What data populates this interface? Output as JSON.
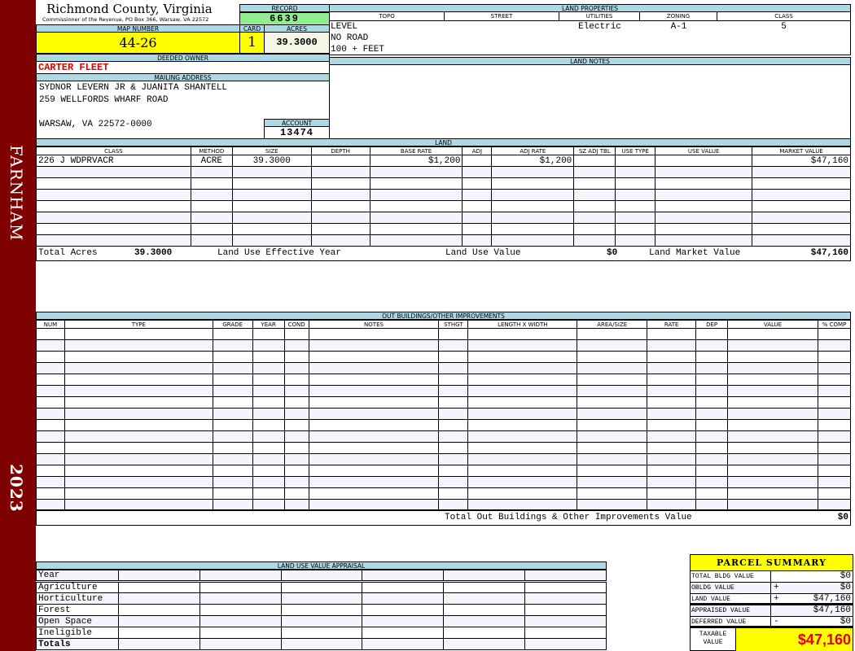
{
  "side": {
    "district": "FARNHAM",
    "year": "2023"
  },
  "header": {
    "title": "Richmond County, Virginia",
    "subtitle": "Commissioner of the Revenue, PO Box 366, Warsaw, VA 22572"
  },
  "record": {
    "label": "RECORD",
    "value": "6639"
  },
  "map": {
    "label": "MAP NUMBER",
    "value": "44-26"
  },
  "card": {
    "label": "CARD",
    "value": "1"
  },
  "acres": {
    "label": "ACRES",
    "value": "39.3000"
  },
  "owner": {
    "label": "DEEDED OWNER",
    "value": "CARTER FLEET"
  },
  "mailing": {
    "label": "MAILING ADDRESS",
    "line1": "SYDNOR LEVERN JR & JUANITA SHANTELL",
    "line2": "259 WELLFORDS WHARF ROAD",
    "line3": "WARSAW, VA 22572-0000"
  },
  "account": {
    "label": "ACCOUNT",
    "value": "13474"
  },
  "land_properties": {
    "label": "LAND PROPERTIES",
    "columns": [
      "TOPO",
      "STREET",
      "UTILITIES",
      "ZONING",
      "CLASS"
    ],
    "topo": [
      "LEVEL",
      "NO ROAD",
      "100 + FEET"
    ],
    "street": "",
    "utilities": "Electric",
    "zoning": "A-1",
    "class": "5"
  },
  "land_notes": {
    "label": "LAND NOTES"
  },
  "land": {
    "label": "LAND",
    "columns": [
      "CLASS",
      "METHOD",
      "SIZE",
      "DEPTH",
      "BASE RATE",
      "ADJ",
      "ADJ RATE",
      "SZ ADJ TBL",
      "USE TYPE",
      "USE VALUE",
      "MARKET VALUE"
    ],
    "rows": [
      [
        "226 J WDPRVACR",
        "ACRE",
        "39.3000",
        "",
        "$1,200",
        "",
        "$1,200",
        "",
        "",
        "",
        "$47,160"
      ]
    ],
    "totals": {
      "acres_label": "Total Acres",
      "acres": "39.3000",
      "eff_label": "Land Use Effective Year",
      "eff": "",
      "use_label": "Land Use Value",
      "use": "$0",
      "market_label": "Land Market Value",
      "market": "$47,160"
    }
  },
  "outbuildings": {
    "label": "OUT BUILDINGS/OTHER IMPROVEMENTS",
    "columns": [
      "NUM",
      "TYPE",
      "GRADE",
      "YEAR",
      "COND",
      "NOTES",
      "STHGT",
      "LENGTH X WIDTH",
      "AREA/SIZE",
      "RATE",
      "DEP",
      "VALUE",
      "% COMP"
    ],
    "total_label": "Total Out Buildings & Other Improvements Value",
    "total": "$0"
  },
  "land_use": {
    "label": "LAND USE VALUE APPRAISAL",
    "rows": [
      "Year",
      "Agriculture",
      "Horticulture",
      "Forest",
      "Open Space",
      "Ineligible",
      "Totals"
    ]
  },
  "summary": {
    "title": "PARCEL SUMMARY",
    "rows": [
      {
        "label": "TOTAL BLDG VALUE",
        "op": "",
        "value": "$0"
      },
      {
        "label": "OBLDG VALUE",
        "op": "+",
        "value": "$0"
      },
      {
        "label": "LAND VALUE",
        "op": "+",
        "value": "$47,160"
      },
      {
        "label": "APPRAISED VALUE",
        "op": "",
        "value": "$47,160"
      },
      {
        "label": "DEFERRED VALUE",
        "op": "-",
        "value": "$0"
      }
    ],
    "taxable_label": "TAXABLE VALUE",
    "taxable": "$47,160"
  },
  "colors": {
    "sidebar": "#7f0000",
    "header": "#add8e6",
    "highlight": "#ffff00",
    "record": "#90ee90",
    "owner": "#e00000"
  }
}
